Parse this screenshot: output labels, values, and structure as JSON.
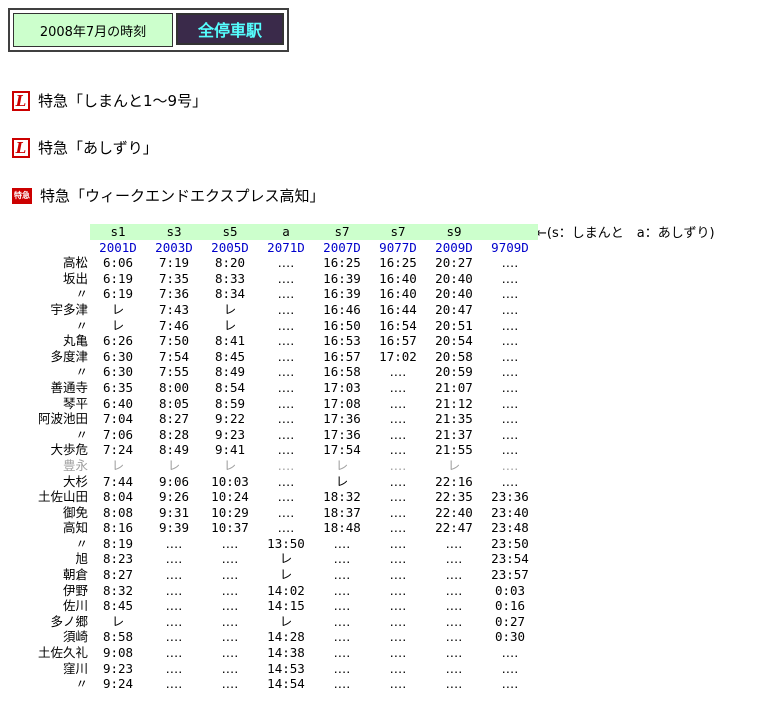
{
  "header": {
    "date_label": "2008年7月の時刻",
    "tab_label": "全停車駅"
  },
  "trains": [
    {
      "icon": "limited-express-l-icon",
      "label": "特急「しまんと1～9号」"
    },
    {
      "icon": "limited-express-l-icon",
      "label": "特急「あしずり」"
    },
    {
      "icon": "tokkyu-mark-icon",
      "icon_text": "特急",
      "label": "特急「ウィークエンドエクスプレス高知」"
    }
  ],
  "note": "←(s：しまんと　a：あしずり)",
  "timetable": {
    "services": [
      "s1",
      "s3",
      "s5",
      "a",
      "s7",
      "s7",
      "s9",
      ""
    ],
    "numbers": [
      "2001D",
      "2003D",
      "2005D",
      "2071D",
      "2007D",
      "9077D",
      "2009D",
      "9709D"
    ],
    "rows": [
      {
        "station": "高松",
        "times": [
          "6:06",
          "7:19",
          "8:20",
          "‥‥",
          "16:25",
          "16:25",
          "20:27",
          "‥‥"
        ]
      },
      {
        "station": "坂出",
        "times": [
          "6:19",
          "7:35",
          "8:33",
          "‥‥",
          "16:39",
          "16:40",
          "20:40",
          "‥‥"
        ]
      },
      {
        "station": "〃",
        "times": [
          "6:19",
          "7:36",
          "8:34",
          "‥‥",
          "16:39",
          "16:40",
          "20:40",
          "‥‥"
        ]
      },
      {
        "station": "宇多津",
        "times": [
          "レ",
          "7:43",
          "レ",
          "‥‥",
          "16:46",
          "16:44",
          "20:47",
          "‥‥"
        ]
      },
      {
        "station": "〃",
        "times": [
          "レ",
          "7:46",
          "レ",
          "‥‥",
          "16:50",
          "16:54",
          "20:51",
          "‥‥"
        ]
      },
      {
        "station": "丸亀",
        "times": [
          "6:26",
          "7:50",
          "8:41",
          "‥‥",
          "16:53",
          "16:57",
          "20:54",
          "‥‥"
        ]
      },
      {
        "station": "多度津",
        "times": [
          "6:30",
          "7:54",
          "8:45",
          "‥‥",
          "16:57",
          "17:02",
          "20:58",
          "‥‥"
        ]
      },
      {
        "station": "〃",
        "times": [
          "6:30",
          "7:55",
          "8:49",
          "‥‥",
          "16:58",
          "‥‥",
          "20:59",
          "‥‥"
        ]
      },
      {
        "station": "善通寺",
        "times": [
          "6:35",
          "8:00",
          "8:54",
          "‥‥",
          "17:03",
          "‥‥",
          "21:07",
          "‥‥"
        ]
      },
      {
        "station": "琴平",
        "times": [
          "6:40",
          "8:05",
          "8:59",
          "‥‥",
          "17:08",
          "‥‥",
          "21:12",
          "‥‥"
        ]
      },
      {
        "station": "阿波池田",
        "times": [
          "7:04",
          "8:27",
          "9:22",
          "‥‥",
          "17:36",
          "‥‥",
          "21:35",
          "‥‥"
        ]
      },
      {
        "station": "〃",
        "times": [
          "7:06",
          "8:28",
          "9:23",
          "‥‥",
          "17:36",
          "‥‥",
          "21:37",
          "‥‥"
        ]
      },
      {
        "station": "大歩危",
        "times": [
          "7:24",
          "8:49",
          "9:41",
          "‥‥",
          "17:54",
          "‥‥",
          "21:55",
          "‥‥"
        ]
      },
      {
        "station": "豊永",
        "gray": true,
        "times": [
          "レ",
          "レ",
          "レ",
          "‥‥",
          "レ",
          "‥‥",
          "レ",
          "‥‥"
        ]
      },
      {
        "station": "大杉",
        "times": [
          "7:44",
          "9:06",
          "10:03",
          "‥‥",
          "レ",
          "‥‥",
          "22:16",
          "‥‥"
        ]
      },
      {
        "station": "土佐山田",
        "times": [
          "8:04",
          "9:26",
          "10:24",
          "‥‥",
          "18:32",
          "‥‥",
          "22:35",
          "23:36"
        ]
      },
      {
        "station": "御免",
        "times": [
          "8:08",
          "9:31",
          "10:29",
          "‥‥",
          "18:37",
          "‥‥",
          "22:40",
          "23:40"
        ]
      },
      {
        "station": "高知",
        "times": [
          "8:16",
          "9:39",
          "10:37",
          "‥‥",
          "18:48",
          "‥‥",
          "22:47",
          "23:48"
        ]
      },
      {
        "station": "〃",
        "times": [
          "8:19",
          "‥‥",
          "‥‥",
          "13:50",
          "‥‥",
          "‥‥",
          "‥‥",
          "23:50"
        ]
      },
      {
        "station": "旭",
        "times": [
          "8:23",
          "‥‥",
          "‥‥",
          "レ",
          "‥‥",
          "‥‥",
          "‥‥",
          "23:54"
        ]
      },
      {
        "station": "朝倉",
        "times": [
          "8:27",
          "‥‥",
          "‥‥",
          "レ",
          "‥‥",
          "‥‥",
          "‥‥",
          "23:57"
        ]
      },
      {
        "station": "伊野",
        "times": [
          "8:32",
          "‥‥",
          "‥‥",
          "14:02",
          "‥‥",
          "‥‥",
          "‥‥",
          "0:03"
        ]
      },
      {
        "station": "佐川",
        "times": [
          "8:45",
          "‥‥",
          "‥‥",
          "14:15",
          "‥‥",
          "‥‥",
          "‥‥",
          "0:16"
        ]
      },
      {
        "station": "多ノ郷",
        "times": [
          "レ",
          "‥‥",
          "‥‥",
          "レ",
          "‥‥",
          "‥‥",
          "‥‥",
          "0:27"
        ]
      },
      {
        "station": "須崎",
        "times": [
          "8:58",
          "‥‥",
          "‥‥",
          "14:28",
          "‥‥",
          "‥‥",
          "‥‥",
          "0:30"
        ]
      },
      {
        "station": "土佐久礼",
        "times": [
          "9:08",
          "‥‥",
          "‥‥",
          "14:38",
          "‥‥",
          "‥‥",
          "‥‥",
          "‥‥"
        ]
      },
      {
        "station": "窪川",
        "times": [
          "9:23",
          "‥‥",
          "‥‥",
          "14:53",
          "‥‥",
          "‥‥",
          "‥‥",
          "‥‥"
        ]
      },
      {
        "station": "〃",
        "times": [
          "9:24",
          "‥‥",
          "‥‥",
          "14:54",
          "‥‥",
          "‥‥",
          "‥‥",
          "‥‥"
        ]
      }
    ]
  }
}
